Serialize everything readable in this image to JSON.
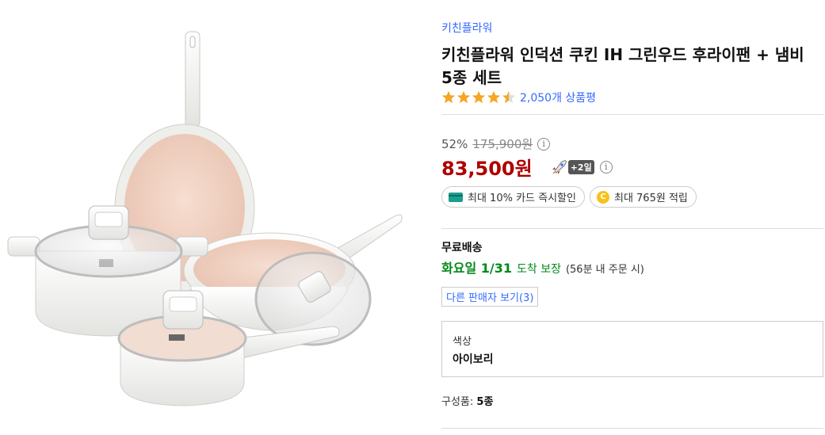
{
  "product": {
    "brand": "키친플라워",
    "title": "키친플라워 인덕션 쿠킨 IH 그린우드 후라이팬 + 냄비 5종 세트",
    "rating": 4.5,
    "review_count": "2,050개 상품평"
  },
  "price": {
    "discount_rate": "52%",
    "original_price": "175,900원",
    "sale_price": "83,500원",
    "rocket_badge": "+2일",
    "info_icon": "i"
  },
  "benefits": {
    "card_discount": "최대 10% 카드 즉시할인",
    "points": "최대 765원 적립",
    "coin_glyph": "C"
  },
  "shipping": {
    "label": "무료배송",
    "date": "화요일 1/31",
    "suffix": "도착 보장",
    "note": "(56분 내 주문 시)"
  },
  "other_sellers": "다른 판매자 보기(3)",
  "option": {
    "label": "색상",
    "value": "아이보리"
  },
  "composition": {
    "label": "구성품:",
    "value": "5종"
  },
  "colors": {
    "link_blue": "#346aff",
    "price_red": "#ae0000",
    "delivery_green": "#00891a",
    "star_orange": "#f5a623"
  }
}
